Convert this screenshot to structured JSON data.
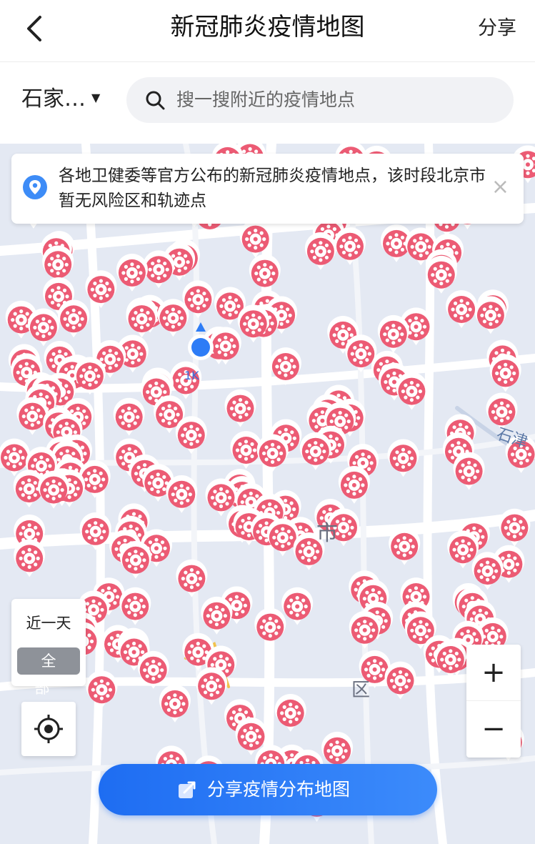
{
  "header": {
    "title": "新冠肺炎疫情地图",
    "share_label": "分享"
  },
  "search": {
    "city": "石家…",
    "placeholder": "搜一搜附近的疫情地点"
  },
  "notice": {
    "text": "各地卫健委等官方公布的新冠肺炎疫情地点，该时段北京市暂无风险区和轨迹点",
    "close": "×"
  },
  "filter": {
    "recent_label": "近一天",
    "all_label": "全部"
  },
  "zoom": {
    "in": "+",
    "out": "−"
  },
  "share_map_label": "分享疫情分布地图",
  "map_labels": {
    "city_char": "市",
    "district_char": "区",
    "road": "石津",
    "scale": "1K"
  },
  "colors": {
    "marker": "#ec5b74",
    "accent": "#1e6df2",
    "map_bg": "#e4e9f3"
  },
  "icons": {
    "back": "chevron-left-icon",
    "search": "search-icon",
    "notice": "location-pin-icon",
    "locate": "crosshair-icon",
    "share": "share-icon",
    "marker": "virus-icon"
  }
}
